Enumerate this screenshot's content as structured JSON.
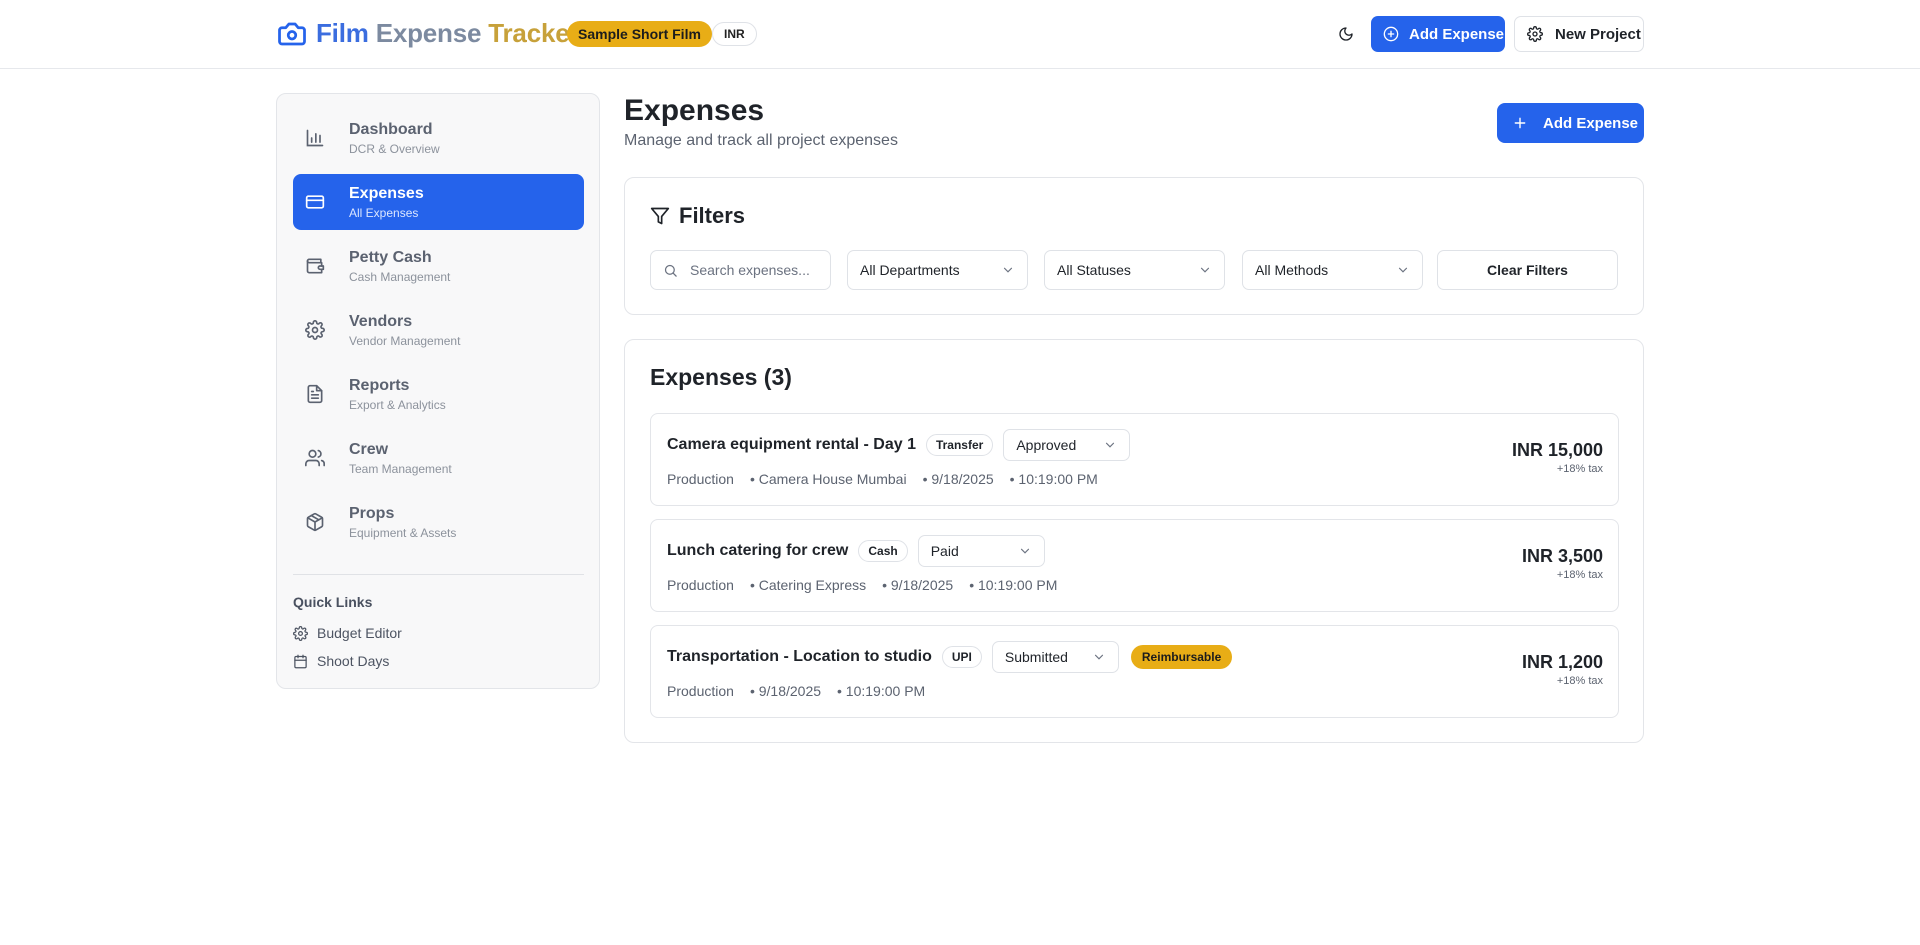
{
  "header": {
    "title_parts": [
      "Film",
      "Expense",
      "Tracker"
    ],
    "project_badge": "Sample Short Film",
    "currency_badge": "INR",
    "add_expense_label": "Add Expense",
    "new_project_label": "New Project",
    "brand_color": "#2563eb",
    "accent_color": "#e8ad16"
  },
  "sidebar": {
    "items": [
      {
        "label": "Dashboard",
        "sub": "DCR & Overview",
        "icon": "bar-chart-icon"
      },
      {
        "label": "Expenses",
        "sub": "All Expenses",
        "icon": "credit-card-icon",
        "active": true
      },
      {
        "label": "Petty Cash",
        "sub": "Cash Management",
        "icon": "wallet-icon"
      },
      {
        "label": "Vendors",
        "sub": "Vendor Management",
        "icon": "gear-icon"
      },
      {
        "label": "Reports",
        "sub": "Export & Analytics",
        "icon": "file-text-icon"
      },
      {
        "label": "Crew",
        "sub": "Team Management",
        "icon": "users-icon"
      },
      {
        "label": "Props",
        "sub": "Equipment & Assets",
        "icon": "package-icon"
      }
    ],
    "quick_links_title": "Quick Links",
    "quick_links": [
      {
        "label": "Budget Editor",
        "icon": "gear-icon"
      },
      {
        "label": "Shoot Days",
        "icon": "calendar-icon"
      }
    ]
  },
  "main": {
    "title": "Expenses",
    "subtitle": "Manage and track all project expenses",
    "add_expense_label": "Add Expense",
    "filters": {
      "title": "Filters",
      "search_placeholder": "Search expenses...",
      "department": "All Departments",
      "status": "All Statuses",
      "method": "All Methods",
      "clear_label": "Clear Filters"
    },
    "list_title": "Expenses (3)",
    "expenses": [
      {
        "title": "Camera equipment rental - Day 1",
        "method": "Transfer",
        "status": "Approved",
        "department": "Production",
        "vendor": "• Camera House Mumbai",
        "date": "• 9/18/2025",
        "time": "• 10:19:00 PM",
        "amount": "INR 15,000",
        "tax": "+18% tax"
      },
      {
        "title": "Lunch catering for crew",
        "method": "Cash",
        "status": "Paid",
        "department": "Production",
        "vendor": "• Catering Express",
        "date": "• 9/18/2025",
        "time": "• 10:19:00 PM",
        "amount": "INR 3,500",
        "tax": "+18% tax"
      },
      {
        "title": "Transportation - Location to studio",
        "method": "UPI",
        "status": "Submitted",
        "reimbursable": "Reimbursable",
        "department": "Production",
        "date": "• 9/18/2025",
        "time": "• 10:19:00 PM",
        "amount": "INR 1,200",
        "tax": "+18% tax"
      }
    ]
  }
}
